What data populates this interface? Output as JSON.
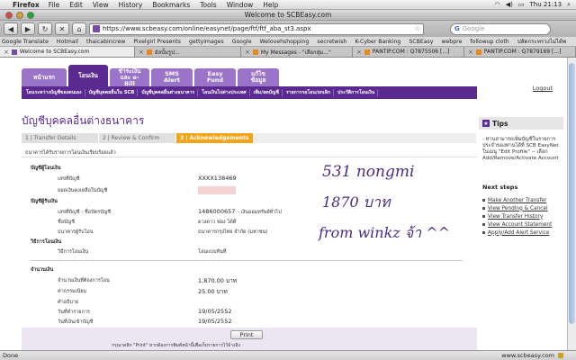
{
  "menubar": {
    "app": "Firefox",
    "items": [
      "File",
      "Edit",
      "View",
      "History",
      "Bookmarks",
      "Tools",
      "Window",
      "Help"
    ],
    "clock": "Thu 21:13"
  },
  "window": {
    "title": "Welcome to SCBEasy.com"
  },
  "toolbar": {
    "url": "https://www.scbeasy.com/online/easynet/page/ftf/ftf_aba_st3.aspx",
    "search_placeholder": "Google"
  },
  "bookmarks": [
    "Google Translate",
    "Hotmail",
    "thaicabincrew",
    "Pixelgirl Presents",
    "gettyimages",
    "Google",
    "Welovehshopping",
    "secretwish",
    "K-Cyber Banking",
    "SCBEasy",
    "webpre",
    "followup cloth",
    "ปลัดกระทรวงไม่ได้พ"
  ],
  "tabs": [
    {
      "label": "Welcome to SCBEasy.com",
      "active": true
    },
    {
      "label": "อัลบั้มรูป...",
      "active": false
    },
    {
      "label": "My Messages - \"เลือกสุ่ม...\"",
      "active": false
    },
    {
      "label": "PANTIP.COM : Q7875506 [...]",
      "active": false
    },
    {
      "label": "PANTIP.COM : Q7879169 [...]",
      "active": false
    }
  ],
  "site_nav": {
    "tabs": [
      "หน้าแรก",
      "โอนเงิน",
      "ชำระเงิน และ e-Bill",
      "SMS Alert",
      "Easy Fund",
      "แก้ไขข้อมูล"
    ],
    "logout": "Logout",
    "subnav": [
      "โอนระหว่างบัญชีของตนเอง",
      "บัญชีบุคคลอื่นใน SCB",
      "บัญชีบุคคลอื่นต่างธนาคาร",
      "โอนเงินไปต่างประเทศ",
      "เพิ่ม/ลดบัญชี",
      "รายการรอโอน/ยกเลิก",
      "ประวัติการโอนเงิน"
    ]
  },
  "page": {
    "title": "บัญชีบุคคลอื่นต่างธนาคาร",
    "steps": [
      "1 | Transfer Details",
      "2 | Review & Confirm",
      "3 | Acknowledgements"
    ],
    "note": "ธนาคารได้รับรายการโอนเงินเรียบร้อยแล้ว"
  },
  "details": {
    "from_header": "บัญชีผู้โอนเงิน",
    "from_account_label": "เลขที่บัญชี",
    "from_account_value": "XXXX138469",
    "from_balance_label": "ยอดเงินคงเหลือในบัญชี",
    "to_header": "บัญชีผู้รับเงิน",
    "to_account_label": "เลขที่บัญชี - ชื่อบัตรบัญชี",
    "to_account_value": "1486000657",
    "to_account_extra": "- เงินออมทรัพย์ทั่วไป",
    "to_name_label": "ชื่อบัญชี",
    "to_name_value": "ดวงดาว ฟอง ได้ดี",
    "to_bank_label": "ธนาคารผู้รับโอน",
    "to_bank_value": "ธนาคารกรุงไทย จำกัด (มหาชน)",
    "method_header": "วิธีการโอนเงิน",
    "method_label": "วิธีการโอนเงิน",
    "method_value": "โอนแบบทันที",
    "amount_header": "จำนวนเงิน",
    "amount_label": "จำนวนเงินที่ต้องการโอน",
    "amount_value": "1,870.00 บาท",
    "fee_label": "ค่าธรรมเนียม",
    "fee_value": "25.00 บาท",
    "memo_label": "คำอธิบาย",
    "date_label": "วันที่ทำรายการ",
    "date_value": "19/05/2552",
    "effective_label": "วันที่เงินเข้าบัญชี",
    "effective_value": "19/05/2552"
  },
  "handwriting": {
    "line1": "531 nongmi",
    "line2": "1870 บาท",
    "line3": "from winkz จ้า ^^"
  },
  "footer": {
    "print": "Print",
    "print_note": "กรุณาคลิก \"Print\" หากต้องการพิมพ์หน้านี้เพื่อเก็บรายการไว้อ้างอิง"
  },
  "sidebar": {
    "tips_title": "Tips",
    "tips_text": "- ท่านสามารถเพิ่มบัญชีในรายการประจำของท่านได้ที่ SCB EasyNet ในเมนู \"Edit Profile\" -- เลือก Add/Remove/Activate Account",
    "next_steps_title": "Next steps",
    "next_steps": [
      "Make Another Transfer",
      "View Pending & Cancel",
      "View Transfer History",
      "View Account Statement",
      "Apply/Add Alert Service"
    ]
  },
  "statusbar": {
    "left": "Done",
    "right": "www.scbeasy.com"
  }
}
